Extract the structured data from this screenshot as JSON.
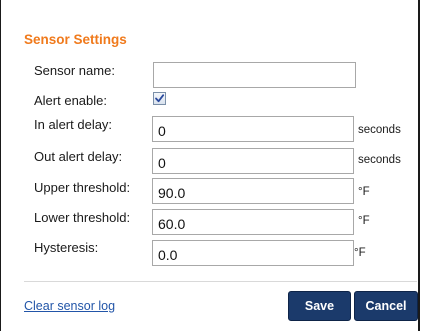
{
  "panel": {
    "title": "Sensor Settings"
  },
  "fields": {
    "sensor_name": {
      "label": "Sensor name:",
      "value": ""
    },
    "alert_enable": {
      "label": "Alert enable:",
      "checked": true
    },
    "in_alert_delay": {
      "label": "In alert delay:",
      "value": "0",
      "unit": "seconds"
    },
    "out_alert_delay": {
      "label": "Out alert delay:",
      "value": "0",
      "unit": "seconds"
    },
    "upper_threshold": {
      "label": "Upper threshold:",
      "value": "90.0",
      "unit": "°F"
    },
    "lower_threshold": {
      "label": "Lower threshold:",
      "value": "60.0",
      "unit": "°F"
    },
    "hysteresis": {
      "label": "Hysteresis:",
      "value": "0.0",
      "unit": "°F"
    }
  },
  "footer": {
    "clear_log_link": "Clear sensor log",
    "save_label": "Save",
    "cancel_label": "Cancel"
  },
  "colors": {
    "title": "#f07a1c",
    "button": "#1b3a6b",
    "link": "#2255a8"
  }
}
